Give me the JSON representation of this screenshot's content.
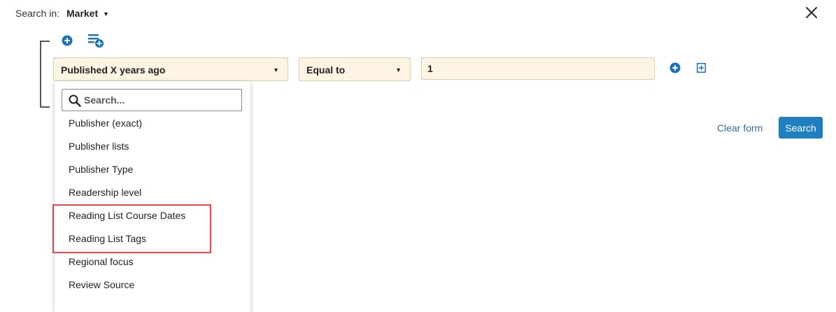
{
  "header": {
    "search_in_label": "Search in:",
    "search_in_value": "Market",
    "caret": "▼"
  },
  "query_row": {
    "field_value": "Published X years ago",
    "operator_value": "Equal to",
    "value_input": "1",
    "caret": "▼"
  },
  "dropdown": {
    "search_placeholder": "Search...",
    "items": [
      "Publisher (exact)",
      "Publisher lists",
      "Publisher Type",
      "Readership level",
      "Reading List Course Dates",
      "Reading List Tags",
      "Regional focus",
      "Review Source"
    ]
  },
  "actions": {
    "clear_form": "Clear form",
    "search": "Search"
  },
  "colors": {
    "accent": "#1f7fc0",
    "field_bg": "#fdf4e3",
    "highlight": "#e0474c",
    "link": "#2f6aa3"
  }
}
